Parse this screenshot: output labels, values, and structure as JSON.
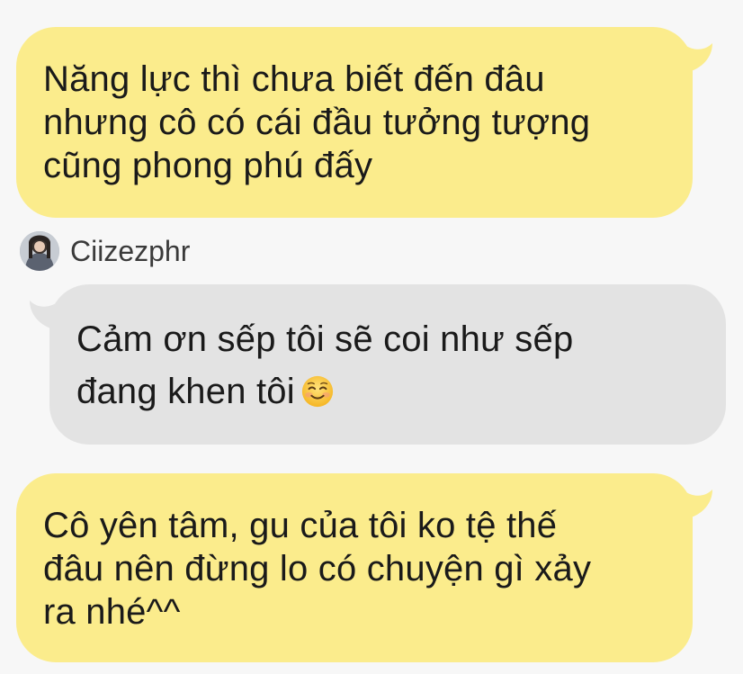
{
  "messages": [
    {
      "direction": "outgoing",
      "text": "Năng lực thì chưa biết đến đâu\nnhưng cô có cái đầu tưởng tượng\ncũng phong phú đấy"
    },
    {
      "direction": "incoming",
      "sender": "Ciizezphr",
      "text": "Cảm ơn sếp tôi sẽ coi như sếp\nđang khen tôi",
      "emoji": "smiling-face-emoji"
    },
    {
      "direction": "outgoing",
      "text": "Cô yên tâm, gu của tôi ko tệ thế\nđâu nên đừng lo có chuyện gì xảy\nra nhé^^"
    }
  ],
  "colors": {
    "background": "#f7f7f7",
    "outgoing_bubble": "#fbec8c",
    "incoming_bubble": "#e3e3e3",
    "text": "#1a1a1a"
  },
  "icons": {
    "avatar": "profile-photo-avatar",
    "emoji": "smiling-face-emoji"
  }
}
